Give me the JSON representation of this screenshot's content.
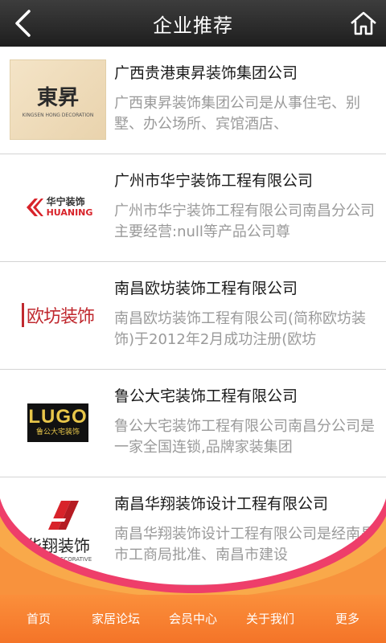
{
  "header": {
    "title": "企业推荐",
    "back_icon": "chevron-left-icon",
    "home_icon": "home-icon"
  },
  "companies": [
    {
      "name": "广西贵港東昇装饰集团公司",
      "desc": "广西東昇装饰集团公司是从事住宅、别墅、办公场所、宾馆酒店、",
      "logo_text": "東昇",
      "logo_sub": "KINGSEN HONG DECORATION"
    },
    {
      "name": "广州市华宁装饰工程有限公司",
      "desc": "广州市华宁装饰工程有限公司南昌分公司主要经营:null等产品公司尊",
      "logo_text": "华宁装饰",
      "logo_sub": "HUANING"
    },
    {
      "name": "南昌欧坊装饰工程有限公司",
      "desc": "南昌欧坊装饰工程有限公司(简称欧坊装饰)于2012年2月成功注册(欧坊",
      "logo_text": "欧坊装饰"
    },
    {
      "name": "鲁公大宅装饰工程有限公司",
      "desc": "鲁公大宅装饰工程有限公司南昌分公司是一家全国连锁,品牌家装集团",
      "logo_text": "LUGO",
      "logo_sub": "鲁公大宅装饰"
    },
    {
      "name": "南昌华翔装饰设计工程有限公司",
      "desc": "南昌华翔装饰设计工程有限公司是经南昌市工商局批准、南昌市建设",
      "logo_text": "华翔装饰",
      "logo_sub": "HUAXIANG DECORATIVE"
    }
  ],
  "bottom_nav": [
    {
      "label": "首页"
    },
    {
      "label": "家居论坛"
    },
    {
      "label": "会员中心"
    },
    {
      "label": "关于我们"
    },
    {
      "label": "更多"
    }
  ],
  "colors": {
    "header_bg": "#2b2b2b",
    "nav_bg": "#f47428",
    "wave_pink": "#ee3e6a",
    "title_text": "#1a1a1a",
    "desc_text": "#9a9a9a"
  }
}
